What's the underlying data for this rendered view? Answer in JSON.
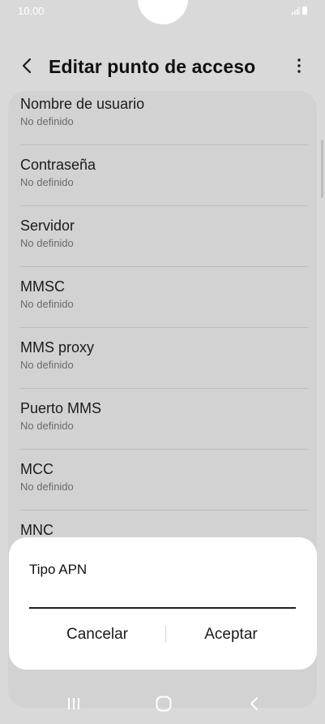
{
  "status_bar": {
    "time": "10.00"
  },
  "header": {
    "title": "Editar punto de acceso",
    "back_icon": "chevron-left-icon",
    "more_icon": "more-vertical-icon"
  },
  "list": {
    "items": [
      {
        "label": "Nombre de usuario",
        "value": "No definido"
      },
      {
        "label": "Contraseña",
        "value": "No definido"
      },
      {
        "label": "Servidor",
        "value": "No definido"
      },
      {
        "label": "MMSC",
        "value": "No definido"
      },
      {
        "label": "MMS proxy",
        "value": "No definido"
      },
      {
        "label": "Puerto MMS",
        "value": "No definido"
      },
      {
        "label": "MCC",
        "value": "No definido"
      },
      {
        "label": "MNC",
        "value": ""
      }
    ]
  },
  "dialog": {
    "title": "Tipo APN",
    "input_value": "",
    "cancel_label": "Cancelar",
    "accept_label": "Aceptar"
  },
  "navbar": {
    "recent_icon": "recent-apps-icon",
    "home_icon": "home-icon",
    "back_icon": "back-icon"
  }
}
